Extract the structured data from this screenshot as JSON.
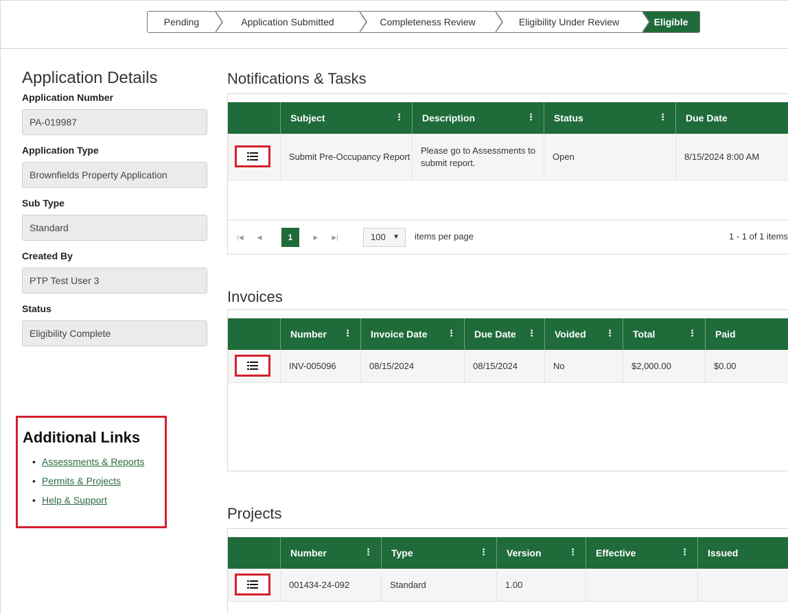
{
  "stepper": {
    "steps": [
      "Pending",
      "Application Submitted",
      "Completeness Review",
      "Eligibility Under Review",
      "Eligible"
    ],
    "active_index": 4
  },
  "details": {
    "title": "Application Details",
    "fields": [
      {
        "label": "Application Number",
        "value": "PA-019987"
      },
      {
        "label": "Application Type",
        "value": "Brownfields Property Application"
      },
      {
        "label": "Sub Type",
        "value": "Standard"
      },
      {
        "label": "Created By",
        "value": "PTP Test User 3"
      },
      {
        "label": "Status",
        "value": "Eligibility Complete"
      }
    ]
  },
  "links": {
    "title": "Additional Links",
    "items": [
      "Assessments & Reports",
      "Permits & Projects",
      "Help & Support"
    ]
  },
  "notifications": {
    "title": "Notifications & Tasks",
    "columns": [
      "Subject",
      "Description",
      "Status",
      "Due Date"
    ],
    "rows": [
      {
        "subject": "Submit Pre-Occupancy Report",
        "description": "Please go to Assessments to submit report.",
        "status": "Open",
        "due_date": "8/15/2024 8:00 AM"
      }
    ],
    "pager": {
      "page": "1",
      "page_size": "100",
      "per_page_label": "items per page",
      "range": "1 - 1 of 1 items"
    }
  },
  "invoices": {
    "title": "Invoices",
    "columns": [
      "Number",
      "Invoice Date",
      "Due Date",
      "Voided",
      "Total",
      "Paid"
    ],
    "rows": [
      {
        "number": "INV-005096",
        "invoice_date": "08/15/2024",
        "due_date": "08/15/2024",
        "voided": "No",
        "total": "$2,000.00",
        "paid": "$0.00"
      }
    ]
  },
  "projects": {
    "title": "Projects",
    "columns": [
      "Number",
      "Type",
      "Version",
      "Effective",
      "Issued"
    ],
    "rows": [
      {
        "number": "001434-24-092",
        "type": "Standard",
        "version": "1.00",
        "effective": "",
        "issued": ""
      }
    ]
  },
  "colors": {
    "brand_green": "#1f6b3a",
    "highlight_red": "#d61f2b",
    "link_green": "#2b6b3f"
  },
  "icons": {
    "row_menu": "list-menu-icon",
    "column_menu": "vertical-dots-icon"
  }
}
